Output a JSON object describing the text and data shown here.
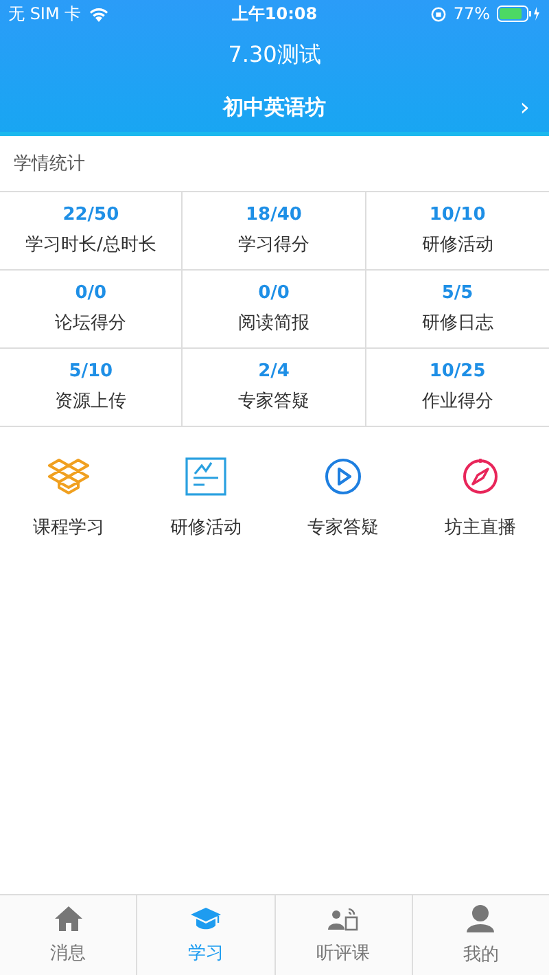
{
  "status_bar": {
    "carrier": "无 SIM 卡",
    "time": "上午10:08",
    "battery": "77%"
  },
  "title": "7.30测试",
  "workshop": {
    "name": "初中英语坊",
    "chevron": "›"
  },
  "section_title": "学情统计",
  "stats": [
    {
      "value": "22/50",
      "label": "学习时长/总时长"
    },
    {
      "value": "18/40",
      "label": "学习得分"
    },
    {
      "value": "10/10",
      "label": "研修活动"
    },
    {
      "value": "0/0",
      "label": "论坛得分"
    },
    {
      "value": "0/0",
      "label": "阅读简报"
    },
    {
      "value": "5/5",
      "label": "研修日志"
    },
    {
      "value": "5/10",
      "label": "资源上传"
    },
    {
      "value": "2/4",
      "label": "专家答疑"
    },
    {
      "value": "10/25",
      "label": "作业得分"
    }
  ],
  "shortcuts": [
    {
      "label": "课程学习"
    },
    {
      "label": "研修活动"
    },
    {
      "label": "专家答疑"
    },
    {
      "label": "坊主直播"
    }
  ],
  "tabs": [
    {
      "label": "消息",
      "selected": false
    },
    {
      "label": "学习",
      "selected": true
    },
    {
      "label": "听评课",
      "selected": false
    },
    {
      "label": "我的",
      "selected": false
    }
  ]
}
